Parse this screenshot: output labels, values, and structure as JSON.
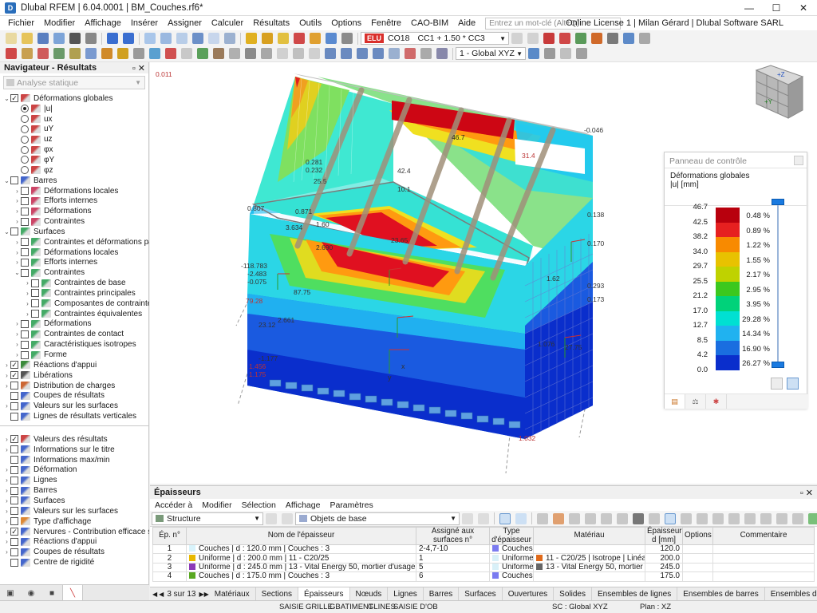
{
  "title": "Dlubal RFEM | 6.04.0001 | BM_Couches.rf6*",
  "menu": [
    "Fichier",
    "Modifier",
    "Affichage",
    "Insérer",
    "Assigner",
    "Calculer",
    "Résultats",
    "Outils",
    "Options",
    "Fenêtre",
    "CAO-BIM",
    "Aide"
  ],
  "search_placeholder": "Entrez un mot-clé (Alt+Q)",
  "license": "Online License 1 | Milan Gérard | Dlubal Software SARL",
  "toolbar": {
    "elu": "ELU",
    "co": "CO18",
    "combo": "CC1 + 1.50 * CC3",
    "view": "1 - Global XYZ"
  },
  "navigator": {
    "title": "Navigateur - Résultats",
    "dropdown": "Analyse statique",
    "items": [
      {
        "label": "Déformations globales",
        "level": 0,
        "exp": "v",
        "cb": "checked",
        "icon": "#c44"
      },
      {
        "label": "|u|",
        "level": 1,
        "radio": "on",
        "icon": "#c44"
      },
      {
        "label": "ux",
        "level": 1,
        "radio": "off",
        "icon": "#c44"
      },
      {
        "label": "uY",
        "level": 1,
        "radio": "off",
        "icon": "#c44"
      },
      {
        "label": "uz",
        "level": 1,
        "radio": "off",
        "icon": "#c44"
      },
      {
        "label": "φx",
        "level": 1,
        "radio": "off",
        "icon": "#c44"
      },
      {
        "label": "φY",
        "level": 1,
        "radio": "off",
        "icon": "#c44"
      },
      {
        "label": "φz",
        "level": 1,
        "radio": "off",
        "icon": "#c44"
      },
      {
        "label": "Barres",
        "level": 0,
        "exp": "v",
        "cb": "empty",
        "icon": "#4466cc"
      },
      {
        "label": "Déformations locales",
        "level": 1,
        "exp": ">",
        "cb": "empty",
        "icon": "#cc4466"
      },
      {
        "label": "Efforts internes",
        "level": 1,
        "exp": ">",
        "cb": "empty",
        "icon": "#cc4466"
      },
      {
        "label": "Déformations",
        "level": 1,
        "exp": ">",
        "cb": "empty",
        "icon": "#cc4466"
      },
      {
        "label": "Contraintes",
        "level": 1,
        "exp": ">",
        "cb": "empty",
        "icon": "#cc4466"
      },
      {
        "label": "Surfaces",
        "level": 0,
        "exp": "v",
        "cb": "empty",
        "icon": "#44aa66"
      },
      {
        "label": "Contraintes et déformations par...",
        "level": 1,
        "exp": ">",
        "cb": "empty",
        "icon": "#44aa66"
      },
      {
        "label": "Déformations locales",
        "level": 1,
        "exp": ">",
        "cb": "empty",
        "icon": "#44aa66"
      },
      {
        "label": "Efforts internes",
        "level": 1,
        "exp": ">",
        "cb": "empty",
        "icon": "#44aa66"
      },
      {
        "label": "Contraintes",
        "level": 1,
        "exp": "v",
        "cb": "empty",
        "icon": "#44aa66"
      },
      {
        "label": "Contraintes de base",
        "level": 2,
        "exp": ">",
        "cb": "empty",
        "icon": "#44aa66"
      },
      {
        "label": "Contraintes principales",
        "level": 2,
        "exp": ">",
        "cb": "empty",
        "icon": "#44aa66"
      },
      {
        "label": "Composantes de contrainte ...",
        "level": 2,
        "exp": ">",
        "cb": "empty",
        "icon": "#44aa66"
      },
      {
        "label": "Contraintes équivalentes",
        "level": 2,
        "exp": ">",
        "cb": "empty",
        "icon": "#44aa66"
      },
      {
        "label": "Déformations",
        "level": 1,
        "exp": ">",
        "cb": "empty",
        "icon": "#44aa66"
      },
      {
        "label": "Contraintes de contact",
        "level": 1,
        "exp": ">",
        "cb": "empty",
        "icon": "#44aa66"
      },
      {
        "label": "Caractéristiques isotropes",
        "level": 1,
        "exp": ">",
        "cb": "empty",
        "icon": "#44aa66"
      },
      {
        "label": "Forme",
        "level": 1,
        "exp": ">",
        "cb": "empty",
        "icon": "#44aa66"
      },
      {
        "label": "Réactions d'appui",
        "level": 0,
        "exp": ">",
        "cb": "checked",
        "icon": "#3a8a3a"
      },
      {
        "label": "Libérations",
        "level": 0,
        "exp": ">",
        "cb": "checked",
        "icon": "#555"
      },
      {
        "label": "Distribution de charges",
        "level": 0,
        "exp": ">",
        "cb": "empty",
        "icon": "#cc6633"
      },
      {
        "label": "Coupes de résultats",
        "level": 0,
        "exp": "",
        "cb": "empty",
        "icon": "#4466cc"
      },
      {
        "label": "Valeurs sur les surfaces",
        "level": 0,
        "exp": ">",
        "cb": "empty",
        "icon": "#4466cc"
      },
      {
        "label": "Lignes de résultats verticales",
        "level": 0,
        "exp": "",
        "cb": "empty",
        "icon": "#4466cc"
      }
    ],
    "items2": [
      {
        "label": "Valeurs des résultats",
        "exp": ">",
        "cb": "checked",
        "icon": "#c44"
      },
      {
        "label": "Informations sur le titre",
        "exp": ">",
        "cb": "empty",
        "icon": "#4466cc"
      },
      {
        "label": "Informations max/min",
        "exp": "",
        "cb": "empty",
        "icon": "#4466cc"
      },
      {
        "label": "Déformation",
        "exp": ">",
        "cb": "empty",
        "icon": "#4466cc"
      },
      {
        "label": "Lignes",
        "exp": ">",
        "cb": "empty",
        "icon": "#4466cc"
      },
      {
        "label": "Barres",
        "exp": ">",
        "cb": "empty",
        "icon": "#4466cc"
      },
      {
        "label": "Surfaces",
        "exp": ">",
        "cb": "empty",
        "icon": "#4466cc"
      },
      {
        "label": "Valeurs sur les surfaces",
        "exp": ">",
        "cb": "empty",
        "icon": "#4466cc"
      },
      {
        "label": "Type d'affichage",
        "exp": ">",
        "cb": "empty",
        "icon": "#dd8833"
      },
      {
        "label": "Nervures - Contribution efficace sur ...",
        "exp": ">",
        "cb": "checked",
        "icon": "#4466cc"
      },
      {
        "label": "Réactions d'appui",
        "exp": ">",
        "cb": "empty",
        "icon": "#4466cc"
      },
      {
        "label": "Coupes de résultats",
        "exp": ">",
        "cb": "empty",
        "icon": "#4466cc"
      },
      {
        "label": "Centre de rigidité",
        "exp": "",
        "cb": "empty",
        "icon": "#4466cc"
      }
    ]
  },
  "model_labels": [
    {
      "t": "0.011",
      "c": "#b33"
    },
    {
      "t": "-0.046",
      "c": "#333"
    },
    {
      "t": "46.7",
      "c": "#222"
    },
    {
      "t": "0.281",
      "c": "#333"
    },
    {
      "t": "0.232",
      "c": "#333"
    },
    {
      "t": "25.5",
      "c": "#333"
    },
    {
      "t": "42.4",
      "c": "#333"
    },
    {
      "t": "31.4",
      "c": "#b33"
    },
    {
      "t": "10.1",
      "c": "#333"
    },
    {
      "t": "0.807",
      "c": "#333"
    },
    {
      "t": "0.871",
      "c": "#333"
    },
    {
      "t": "1.60",
      "c": "#333"
    },
    {
      "t": "3.634",
      "c": "#333"
    },
    {
      "t": "23.65",
      "c": "#333"
    },
    {
      "t": "2.690",
      "c": "#333"
    },
    {
      "t": "-118.783",
      "c": "#333"
    },
    {
      "t": "-2.483",
      "c": "#333"
    },
    {
      "t": "-0.075",
      "c": "#333"
    },
    {
      "t": "87.75",
      "c": "#333"
    },
    {
      "t": "79.28",
      "c": "#b33"
    },
    {
      "t": "2.661",
      "c": "#333"
    },
    {
      "t": "23.12",
      "c": "#333"
    },
    {
      "t": "-1.177",
      "c": "#333"
    },
    {
      "t": "1.456",
      "c": "#b33"
    },
    {
      "t": "1.175",
      "c": "#b33"
    },
    {
      "t": "0.138",
      "c": "#333"
    },
    {
      "t": "0.170",
      "c": "#333"
    },
    {
      "t": "1.62",
      "c": "#333"
    },
    {
      "t": "0.293",
      "c": "#333"
    },
    {
      "t": "0.173",
      "c": "#333"
    },
    {
      "t": "27.75",
      "c": "#333"
    },
    {
      "t": "1.032",
      "c": "#b33"
    },
    {
      "t": "1.076",
      "c": "#333"
    }
  ],
  "control_panel": {
    "title": "Panneau de contrôle",
    "sub1": "Déformations globales",
    "sub2": "|u| [mm]",
    "legend": [
      {
        "v": "46.7",
        "c": "#b8000d",
        "p": "0.48 %"
      },
      {
        "v": "42.5",
        "c": "#e62020",
        "p": "0.89 %"
      },
      {
        "v": "38.2",
        "c": "#f88a00",
        "p": "1.22 %"
      },
      {
        "v": "34.0",
        "c": "#e8c200",
        "p": "1.55 %"
      },
      {
        "v": "29.7",
        "c": "#bfd200",
        "p": "2.17 %"
      },
      {
        "v": "25.5",
        "c": "#3cc81e",
        "p": "2.95 %"
      },
      {
        "v": "21.2",
        "c": "#00d27a",
        "p": "3.95 %"
      },
      {
        "v": "17.0",
        "c": "#00e0d2",
        "p": "29.28 %"
      },
      {
        "v": "12.7",
        "c": "#20b2f0",
        "p": "14.34 %"
      },
      {
        "v": "8.5",
        "c": "#1a6ee0",
        "p": "16.90 %"
      },
      {
        "v": "4.2",
        "c": "#0a2ecc",
        "p": "26.27 %"
      },
      {
        "v": "0.0",
        "c": "#0a0a8a",
        "p": ""
      }
    ]
  },
  "thickness": {
    "title": "Épaisseurs",
    "menu": [
      "Accéder à",
      "Modifier",
      "Sélection",
      "Affichage",
      "Paramètres"
    ],
    "combo1": "Structure",
    "combo2": "Objets de base",
    "headers": [
      "Ép. n°",
      "Nom de l'épaisseur",
      "Assigné aux surfaces n°",
      "Type d'épaisseur",
      "Matériau",
      "Épaisseur d [mm]",
      "Options",
      "Commentaire"
    ],
    "rows": [
      {
        "n": "1",
        "c": "#d8f3fb",
        "name": "Couches | d : 120.0 mm | Couches : 3",
        "surf": "2-4,7-10",
        "tc": "#7b7bf0",
        "type": "Couches",
        "mc": "",
        "mat": "",
        "d": "120.0"
      },
      {
        "n": "2",
        "c": "#e8b800",
        "name": "Uniforme | d : 200.0 mm | 11 - C20/25",
        "surf": "1",
        "tc": "#d8f0f8",
        "type": "Uniforme",
        "mc": "#e06a1a",
        "mat": "11 - C20/25 | Isotrope | Linéaire él...",
        "d": "200.0"
      },
      {
        "n": "3",
        "c": "#8c3ab8",
        "name": "Uniforme | d : 245.0 mm | 13 - Vital Energy 50, mortier d'usage courant M10",
        "surf": "5",
        "tc": "#d8f0f8",
        "type": "Uniforme",
        "mc": "#666",
        "mat": "13 - Vital Energy 50, mortier d'usa...",
        "d": "245.0"
      },
      {
        "n": "4",
        "c": "#58a820",
        "name": "Couches | d : 175.0 mm | Couches : 3",
        "surf": "6",
        "tc": "#7b7bf0",
        "type": "Couches",
        "mc": "",
        "mat": "",
        "d": "175.0"
      }
    ]
  },
  "tabs": {
    "page": "3 sur 13",
    "items": [
      "Matériaux",
      "Sections",
      "Épaisseurs",
      "Nœuds",
      "Lignes",
      "Barres",
      "Surfaces",
      "Ouvertures",
      "Solides",
      "Ensembles de lignes",
      "Ensembles de barres",
      "Ensembles de surfaces",
      "Ensembles"
    ],
    "active": 2
  },
  "status": {
    "items": [
      "SAISIE",
      "GRILLE",
      "GBATIMENT",
      "GLINES",
      "SAISIE D'OB"
    ],
    "sc": "SC : Global XYZ",
    "plan": "Plan : XZ"
  }
}
